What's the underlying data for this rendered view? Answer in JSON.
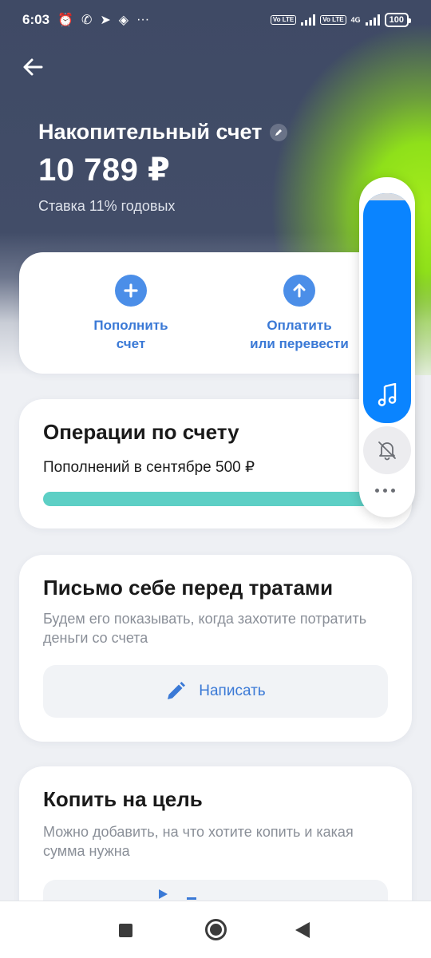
{
  "status_bar": {
    "time": "6:03",
    "more": "···",
    "volte1": "Vo LTE",
    "volte2": "Vo LTE",
    "net": "4G",
    "battery": "100"
  },
  "header": {
    "title": "Накопительный счет",
    "balance": "10 789 ₽",
    "rate": "Ставка 11% годовых"
  },
  "actions": [
    {
      "line1": "Пополнить",
      "line2": "счет"
    },
    {
      "line1": "Оплатить",
      "line2": "или перевести"
    }
  ],
  "operations": {
    "title": "Операции по счету",
    "subtitle": "Пополнений в сентябре 500 ₽",
    "progress": 1.0
  },
  "letter": {
    "title": "Письмо себе перед тратами",
    "description": "Будем его показывать, когда захотите потратить деньги со счета",
    "button": "Написать"
  },
  "goal": {
    "title": "Копить на цель",
    "description": "Можно добавить, на что хотите копить и какая сумма нужна"
  },
  "volume_panel": {
    "level": 0.97
  },
  "colors": {
    "header_bg": "#424d68",
    "accent_green": "#a4ec1c",
    "accent_blue": "#4b8ee8",
    "link_blue": "#3a79d6",
    "progress_teal": "#5dcfc5",
    "volume_blue": "#0a84ff"
  }
}
